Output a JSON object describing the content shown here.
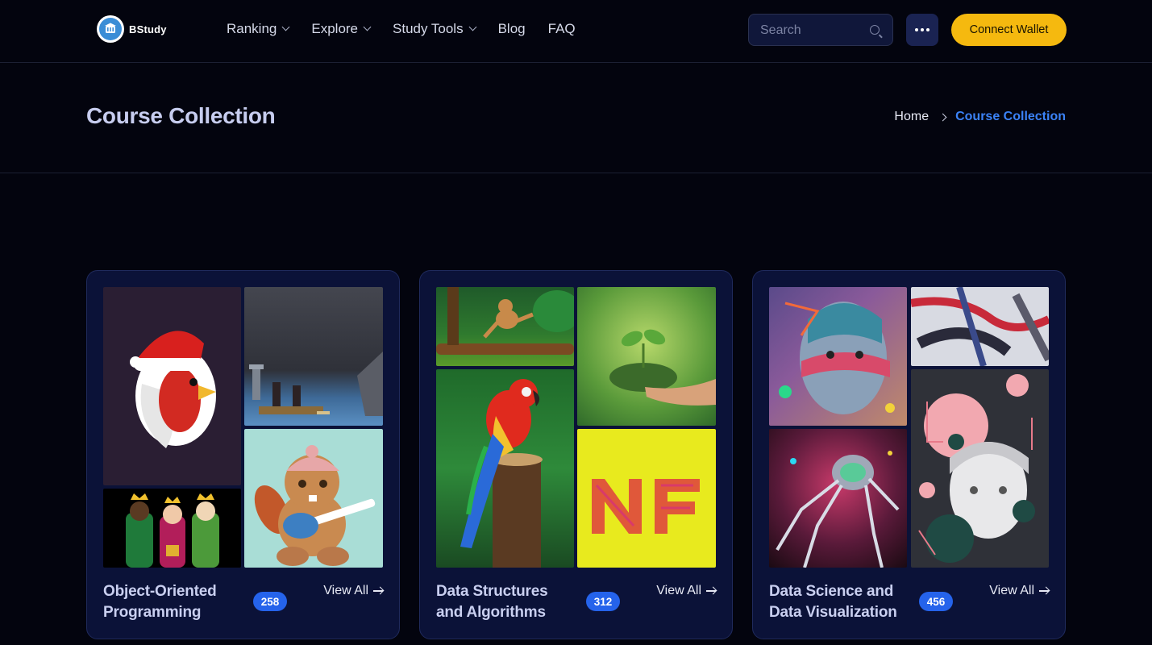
{
  "brand": {
    "name": "BStudy"
  },
  "nav": {
    "items": [
      {
        "label": "Ranking",
        "has_dropdown": true
      },
      {
        "label": "Explore",
        "has_dropdown": true
      },
      {
        "label": "Study Tools",
        "has_dropdown": true
      },
      {
        "label": "Blog",
        "has_dropdown": false
      },
      {
        "label": "FAQ",
        "has_dropdown": false
      }
    ]
  },
  "search": {
    "placeholder": "Search",
    "value": ""
  },
  "header_actions": {
    "connect_label": "Connect Wallet",
    "more_icon": "ellipsis-icon"
  },
  "page": {
    "title": "Course Collection",
    "breadcrumb": {
      "home": "Home",
      "current": "Course Collection"
    }
  },
  "collections": [
    {
      "title": "Object-Oriented Programming",
      "count": "258",
      "view_all": "View All",
      "images": [
        "rooster-santa-hat",
        "pixel-boat-scene",
        "three-kings",
        "beaver-guitar"
      ]
    },
    {
      "title": "Data Structures and Algorithms",
      "count": "312",
      "view_all": "View All",
      "images": [
        "jungle-monkey",
        "plant-in-hands",
        "scarlet-macaw",
        "nf-letters"
      ]
    },
    {
      "title": "Data Science and Data Visualization",
      "count": "456",
      "view_all": "View All",
      "images": [
        "colorful-statue-head",
        "abstract-brushstrokes",
        "neon-robot-spider",
        "bust-with-circles"
      ]
    }
  ],
  "colors": {
    "accent": "#3b82f6",
    "cta": "#f5b90f",
    "badge": "#2563eb",
    "card_bg": "#0b1238",
    "page_bg": "#03040e"
  }
}
